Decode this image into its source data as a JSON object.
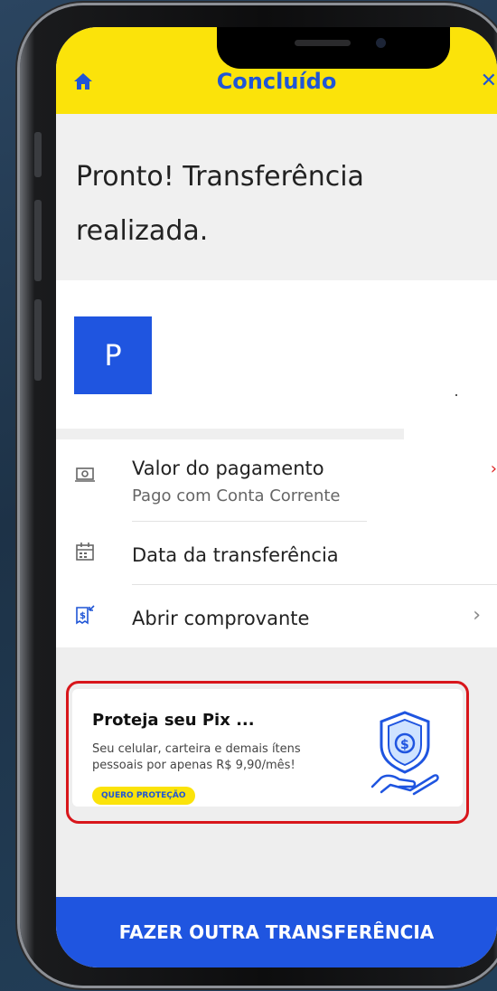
{
  "header": {
    "title": "Concluído",
    "home_icon": "home-icon",
    "close_icon": "close-icon",
    "background": "#fbe30a",
    "accent": "#1f55d6"
  },
  "hero": {
    "title": "Pronto! Transferência realizada."
  },
  "recipient": {
    "initial": "P",
    "avatar_color": "#1f55e0"
  },
  "details": {
    "payment": {
      "label": "Valor do pagamento",
      "sub": "Pago com Conta Corrente",
      "icon": "money-icon"
    },
    "date": {
      "label": "Data da transferência",
      "icon": "calendar-icon"
    },
    "receipt": {
      "label": "Abrir comprovante",
      "icon": "receipt-icon"
    }
  },
  "promo": {
    "title": "Proteja seu Pix ...",
    "description": "Seu celular, carteira e demais ítens pessoais por apenas R$ 9,90/mês!",
    "button": "QUERO PROTEÇÃO",
    "icon": "shield-hand-icon"
  },
  "cta": {
    "label": "FAZER OUTRA TRANSFERÊNCIA"
  }
}
